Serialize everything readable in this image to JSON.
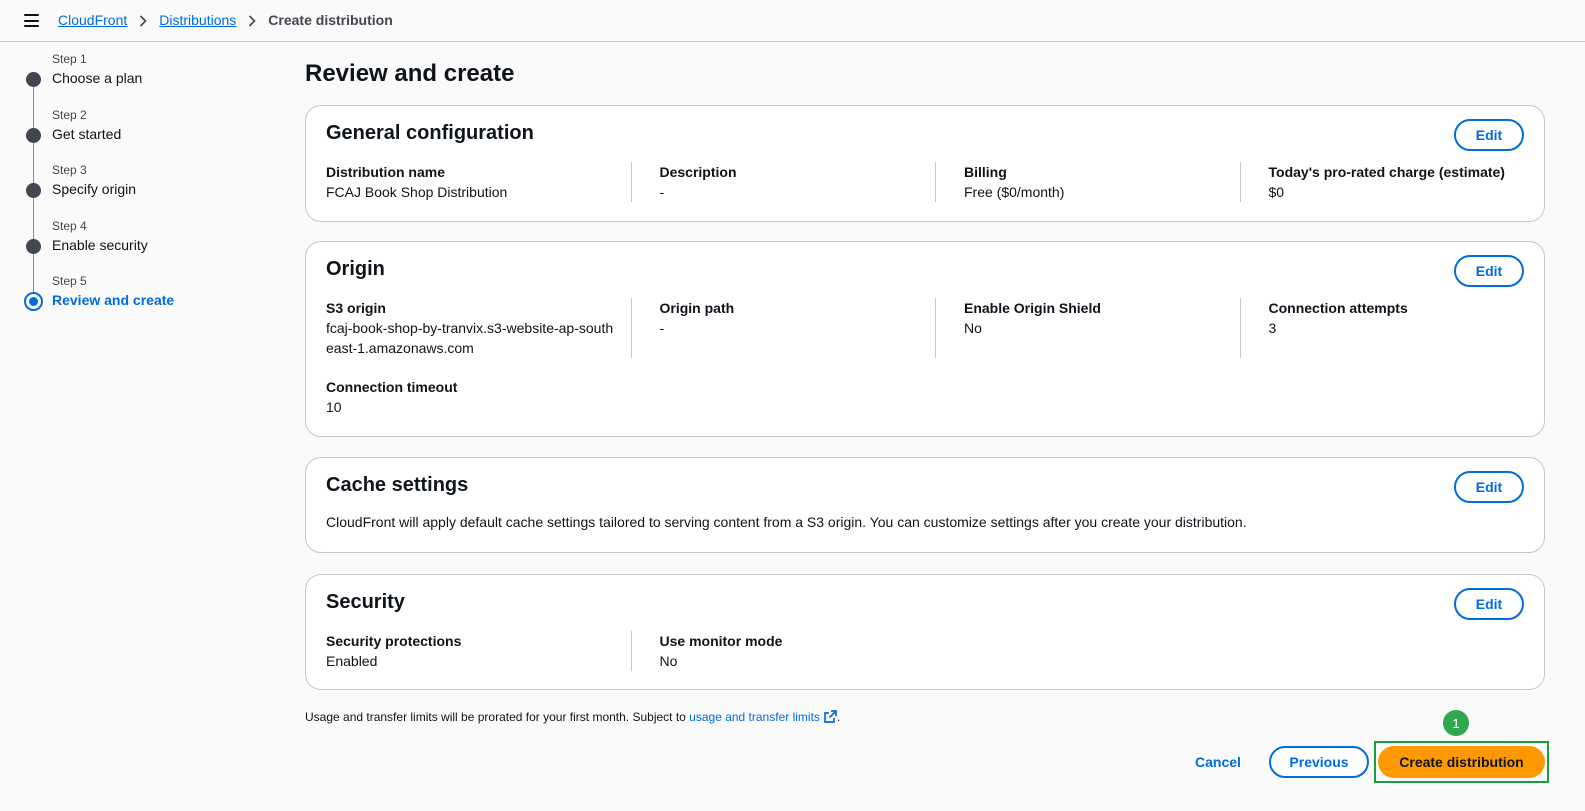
{
  "breadcrumb": {
    "items": [
      "CloudFront",
      "Distributions"
    ],
    "current": "Create distribution"
  },
  "stepper": {
    "steps": [
      {
        "num": "Step 1",
        "title": "Choose a plan"
      },
      {
        "num": "Step 2",
        "title": "Get started"
      },
      {
        "num": "Step 3",
        "title": "Specify origin"
      },
      {
        "num": "Step 4",
        "title": "Enable security"
      },
      {
        "num": "Step 5",
        "title": "Review and create"
      }
    ],
    "active_index": 4
  },
  "page_title": "Review and create",
  "edit_label": "Edit",
  "general": {
    "title": "General configuration",
    "fields": [
      {
        "k": "Distribution name",
        "v": "FCAJ Book Shop Distribution"
      },
      {
        "k": "Description",
        "v": "-"
      },
      {
        "k": "Billing",
        "v": "Free ($0/month)"
      },
      {
        "k": "Today's pro-rated charge (estimate)",
        "v": "$0"
      }
    ]
  },
  "origin": {
    "title": "Origin",
    "fields": [
      {
        "k": "S3 origin",
        "v": "fcaj-book-shop-by-tranvix.s3-website-ap-southeast-1.amazonaws.com"
      },
      {
        "k": "Origin path",
        "v": "-"
      },
      {
        "k": "Enable Origin Shield",
        "v": "No"
      },
      {
        "k": "Connection attempts",
        "v": "3"
      }
    ],
    "fields2": [
      {
        "k": "Connection timeout",
        "v": "10"
      }
    ]
  },
  "cache": {
    "title": "Cache settings",
    "text": "CloudFront will apply default cache settings tailored to serving content from a S3 origin. You can customize settings after you create your distribution."
  },
  "security": {
    "title": "Security",
    "fields": [
      {
        "k": "Security protections",
        "v": "Enabled"
      },
      {
        "k": "Use monitor mode",
        "v": "No"
      }
    ]
  },
  "footnote": {
    "text": "Usage and transfer limits will be prorated for your first month. Subject to ",
    "link": "usage and transfer limits",
    "end": "."
  },
  "actions": {
    "cancel": "Cancel",
    "previous": "Previous",
    "create": "Create distribution"
  },
  "badge": "1",
  "colors": {
    "link": "#006ce0",
    "primary_button": "#ff9900",
    "highlight": "#1b9e3e"
  }
}
